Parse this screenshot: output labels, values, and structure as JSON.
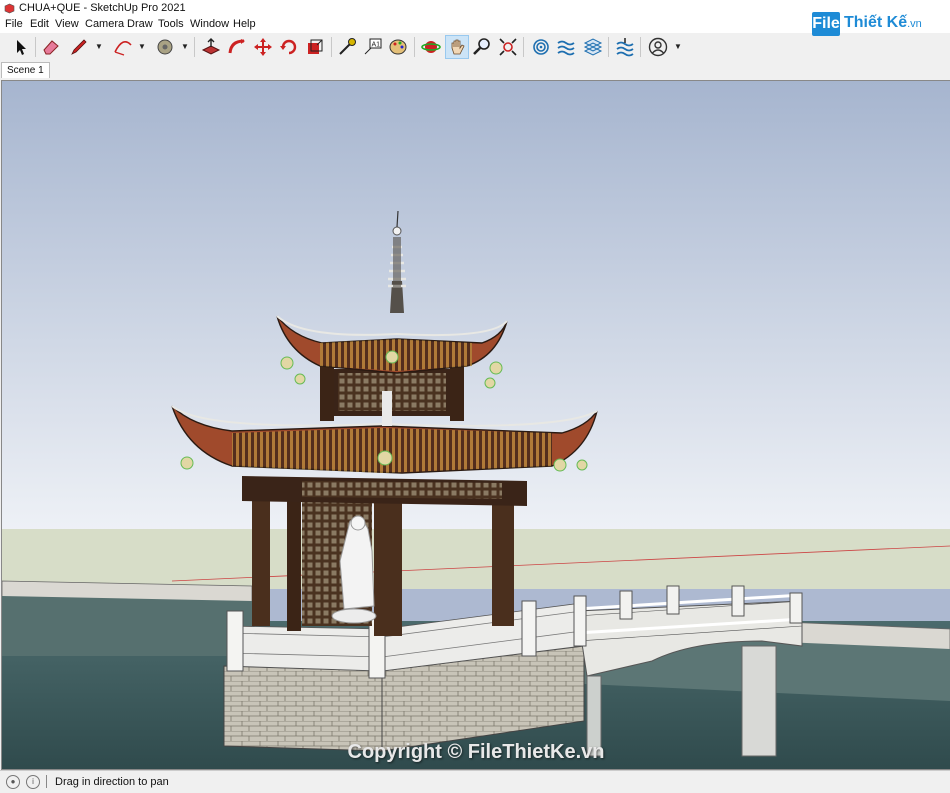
{
  "window": {
    "title": "CHUA+QUE - SketchUp Pro 2021"
  },
  "menu": [
    "File",
    "Edit",
    "View",
    "Camera",
    "Draw",
    "Tools",
    "Window",
    "Help"
  ],
  "toolbar": {
    "tools": [
      "select",
      "eraser",
      "line",
      "arc",
      "paint-bucket",
      "push-pull",
      "follow-me",
      "move",
      "rotate",
      "scale",
      "tape-measure",
      "text",
      "paint",
      "orbit",
      "pan",
      "zoom",
      "zoom-extents",
      "sandbox-from-contours",
      "sandbox-from-scratch",
      "stamp",
      "drape",
      "user-account"
    ],
    "active_tool": "pan"
  },
  "logo": {
    "box_text": "File",
    "name": "Thiết Kế",
    "suffix": ".vn"
  },
  "scenes": [
    "Scene 1"
  ],
  "viewport": {
    "watermark": "Copyright © FileThietKe.vn"
  },
  "statusbar": {
    "message": "Drag in direction to pan"
  },
  "colors": {
    "accent": "#1e8bd6",
    "sky_top": "#adb9d1",
    "ground": "#d7ddc8",
    "water": "#3d5e60"
  }
}
